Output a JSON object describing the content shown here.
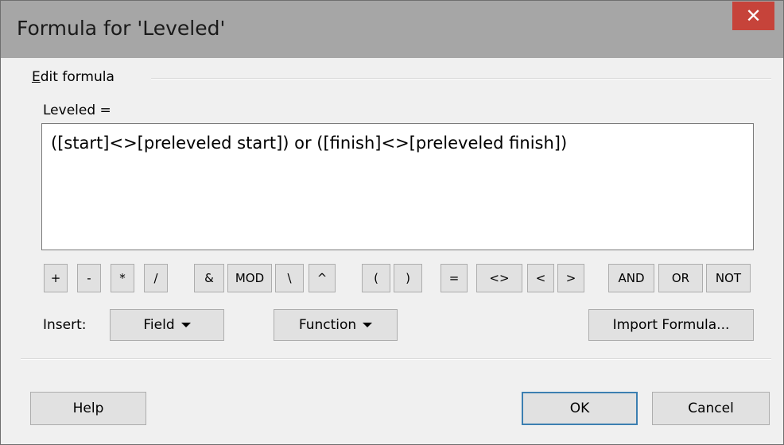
{
  "window": {
    "title": "Formula for 'Leveled'",
    "close_glyph": "✕"
  },
  "group": {
    "label_first": "E",
    "label_rest": "dit formula"
  },
  "formula": {
    "label": "Leveled =",
    "value": "([start]<>[preleveled start]) or ([finish]<>[preleveled finish])"
  },
  "operators": [
    "+",
    "-",
    "*",
    "/",
    "&",
    "MOD",
    "\\",
    "^",
    "(",
    ")",
    "=",
    "<>",
    "<",
    ">",
    "AND",
    "OR",
    "NOT"
  ],
  "insert": {
    "label": "Insert:",
    "field_label": "Field",
    "function_label": "Function",
    "import_label": "Import Formula..."
  },
  "footer": {
    "help_label": "Help",
    "ok_label": "OK",
    "cancel_label": "Cancel"
  },
  "colors": {
    "titlebar": "#a6a6a6",
    "close": "#c6433a",
    "button": "#e1e1e1",
    "default_button_border": "#3c7fb1"
  }
}
